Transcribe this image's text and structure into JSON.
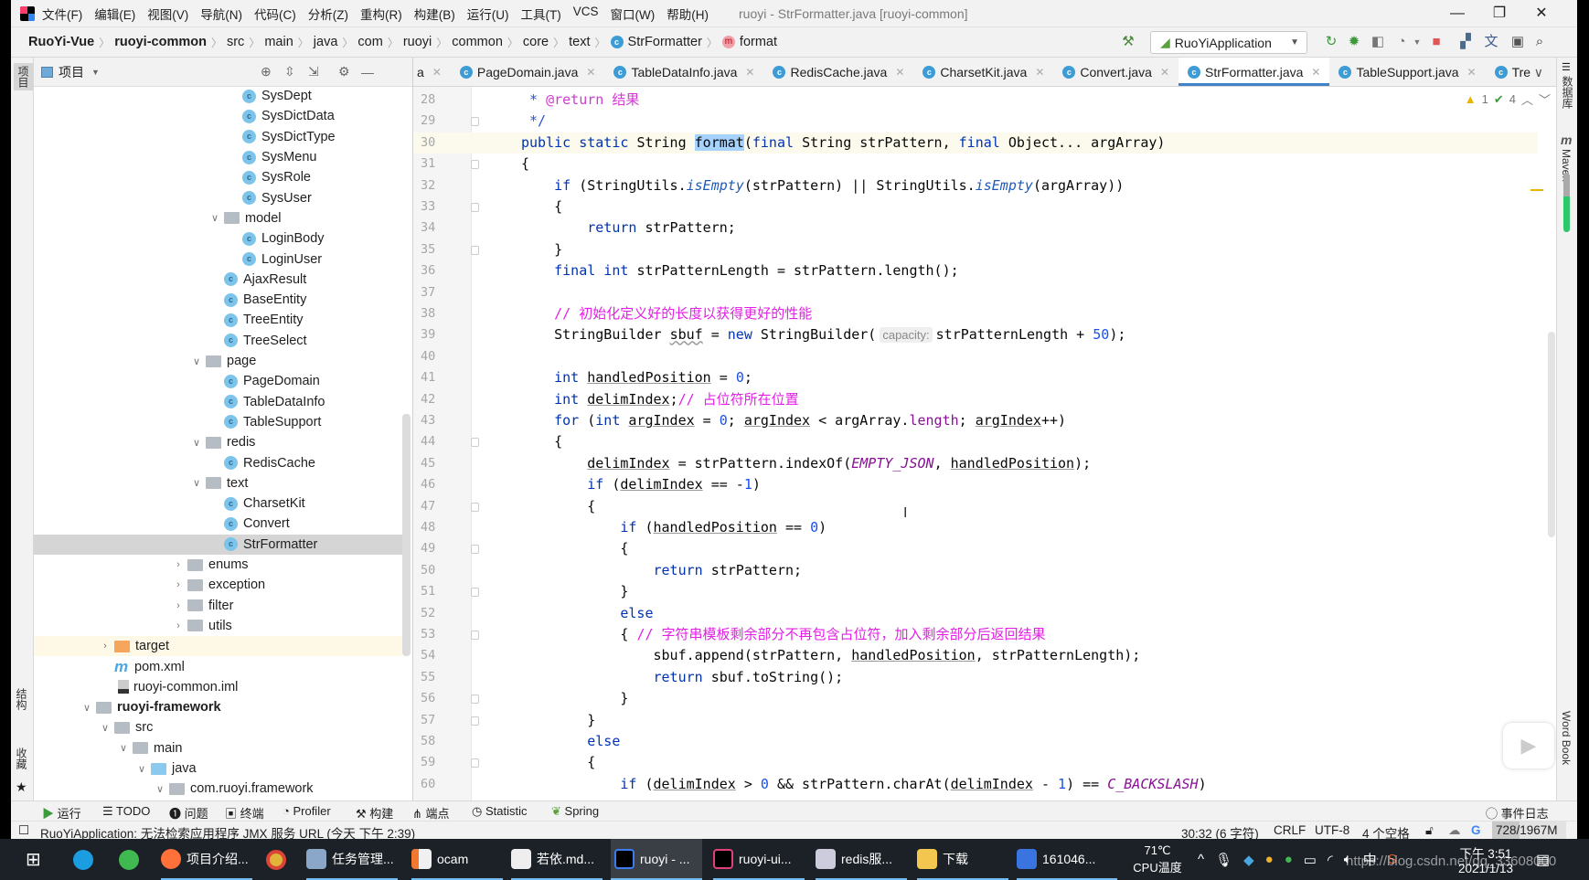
{
  "window": {
    "title": "ruoyi - StrFormatter.java [ruoyi-common]",
    "menu": [
      "文件(F)",
      "编辑(E)",
      "视图(V)",
      "导航(N)",
      "代码(C)",
      "分析(Z)",
      "重构(R)",
      "构建(B)",
      "运行(U)",
      "工具(T)",
      "VCS",
      "窗口(W)",
      "帮助(H)"
    ],
    "controls": {
      "minimize": "—",
      "restore": "❐",
      "close": "✕"
    }
  },
  "breadcrumb": [
    "RuoYi-Vue",
    "ruoyi-common",
    "src",
    "main",
    "java",
    "com",
    "ruoyi",
    "common",
    "core",
    "text",
    "StrFormatter",
    "format"
  ],
  "toolbar": {
    "run_config": "RuoYiApplication",
    "icons": [
      "hammer-icon",
      "rerun-icon",
      "debug-icon",
      "coverage-icon",
      "profile-icon",
      "stop-icon",
      "project-structure-icon",
      "translate-icon",
      "presentation-icon",
      "search-icon"
    ]
  },
  "project_panel": {
    "title": "项目",
    "tree": [
      {
        "label": "SysDept",
        "depth": 8,
        "kind": "class"
      },
      {
        "label": "SysDictData",
        "depth": 8,
        "kind": "class"
      },
      {
        "label": "SysDictType",
        "depth": 8,
        "kind": "class"
      },
      {
        "label": "SysMenu",
        "depth": 8,
        "kind": "class"
      },
      {
        "label": "SysRole",
        "depth": 8,
        "kind": "class"
      },
      {
        "label": "SysUser",
        "depth": 8,
        "kind": "class"
      },
      {
        "label": "model",
        "depth": 7,
        "kind": "package",
        "expanded": true
      },
      {
        "label": "LoginBody",
        "depth": 8,
        "kind": "class"
      },
      {
        "label": "LoginUser",
        "depth": 8,
        "kind": "class"
      },
      {
        "label": "AjaxResult",
        "depth": 7,
        "kind": "class"
      },
      {
        "label": "BaseEntity",
        "depth": 7,
        "kind": "class"
      },
      {
        "label": "TreeEntity",
        "depth": 7,
        "kind": "class"
      },
      {
        "label": "TreeSelect",
        "depth": 7,
        "kind": "class"
      },
      {
        "label": "page",
        "depth": 6,
        "kind": "package",
        "expanded": true
      },
      {
        "label": "PageDomain",
        "depth": 7,
        "kind": "class"
      },
      {
        "label": "TableDataInfo",
        "depth": 7,
        "kind": "class"
      },
      {
        "label": "TableSupport",
        "depth": 7,
        "kind": "class"
      },
      {
        "label": "redis",
        "depth": 6,
        "kind": "package",
        "expanded": true
      },
      {
        "label": "RedisCache",
        "depth": 7,
        "kind": "class"
      },
      {
        "label": "text",
        "depth": 6,
        "kind": "package",
        "expanded": true
      },
      {
        "label": "CharsetKit",
        "depth": 7,
        "kind": "class"
      },
      {
        "label": "Convert",
        "depth": 7,
        "kind": "class"
      },
      {
        "label": "StrFormatter",
        "depth": 7,
        "kind": "class",
        "selected": true
      },
      {
        "label": "enums",
        "depth": 5,
        "kind": "package",
        "expanded": false
      },
      {
        "label": "exception",
        "depth": 5,
        "kind": "package",
        "expanded": false
      },
      {
        "label": "filter",
        "depth": 5,
        "kind": "package",
        "expanded": false
      },
      {
        "label": "utils",
        "depth": 5,
        "kind": "package",
        "expanded": false
      },
      {
        "label": "target",
        "depth": 1,
        "kind": "excluded-folder",
        "expanded": false
      },
      {
        "label": "pom.xml",
        "depth": 1,
        "kind": "maven"
      },
      {
        "label": "ruoyi-common.iml",
        "depth": 1,
        "kind": "iml"
      },
      {
        "label": "ruoyi-framework",
        "depth": 0,
        "kind": "module",
        "expanded": true
      },
      {
        "label": "src",
        "depth": 1,
        "kind": "folder",
        "expanded": true
      },
      {
        "label": "main",
        "depth": 2,
        "kind": "folder",
        "expanded": true
      },
      {
        "label": "java",
        "depth": 3,
        "kind": "source-folder",
        "expanded": true
      },
      {
        "label": "com.ruoyi.framework",
        "depth": 4,
        "kind": "package",
        "expanded": true
      }
    ]
  },
  "left_strip": {
    "top": "项目",
    "structure": "结构",
    "favorites": "收藏"
  },
  "right_strip": {
    "database": "数据库",
    "maven": "Maven",
    "wordbook": "Word Book"
  },
  "editor": {
    "tabs": [
      {
        "label": "a"
      },
      {
        "label": "PageDomain.java"
      },
      {
        "label": "TableDataInfo.java"
      },
      {
        "label": "RedisCache.java"
      },
      {
        "label": "CharsetKit.java"
      },
      {
        "label": "Convert.java"
      },
      {
        "label": "StrFormatter.java",
        "active": true
      },
      {
        "label": "TableSupport.java"
      },
      {
        "label": "Tre"
      }
    ],
    "inspections": {
      "warnings": "1",
      "typos": "4"
    },
    "current_line": 30,
    "lines": [
      {
        "n": 28,
        "tokens": [
          [
            " * ",
            "d"
          ],
          [
            "@return",
            "dt"
          ],
          [
            " 结果",
            "dt"
          ]
        ]
      },
      {
        "n": 29,
        "fold": true,
        "tokens": [
          [
            " */",
            "d"
          ]
        ]
      },
      {
        "n": 30,
        "tokens": [
          [
            "public static ",
            "k"
          ],
          [
            "String ",
            "t"
          ],
          [
            "format",
            "s"
          ],
          [
            "(",
            "t"
          ],
          [
            "final ",
            "k"
          ],
          [
            "String strPattern, ",
            "t"
          ],
          [
            "final ",
            "k"
          ],
          [
            "Object... argArray)",
            "t"
          ]
        ]
      },
      {
        "n": 31,
        "fold": true,
        "tokens": [
          [
            "{",
            "t"
          ]
        ]
      },
      {
        "n": 32,
        "tokens": [
          [
            "    ",
            "t"
          ],
          [
            "if ",
            "k"
          ],
          [
            "(StringUtils.",
            "t"
          ],
          [
            "isEmpty",
            "i"
          ],
          [
            "(strPattern) || StringUtils.",
            "t"
          ],
          [
            "isEmpty",
            "i"
          ],
          [
            "(argArray))",
            "t"
          ]
        ]
      },
      {
        "n": 33,
        "fold": true,
        "tokens": [
          [
            "    {",
            "t"
          ]
        ]
      },
      {
        "n": 34,
        "tokens": [
          [
            "        ",
            "t"
          ],
          [
            "return ",
            "k"
          ],
          [
            "strPattern;",
            "t"
          ]
        ]
      },
      {
        "n": 35,
        "fold": true,
        "tokens": [
          [
            "    }",
            "t"
          ]
        ]
      },
      {
        "n": 36,
        "tokens": [
          [
            "    ",
            "t"
          ],
          [
            "final int ",
            "k"
          ],
          [
            "strPatternLength = strPattern.length();",
            "t"
          ]
        ]
      },
      {
        "n": 37,
        "tokens": []
      },
      {
        "n": 38,
        "tokens": [
          [
            "    ",
            "t"
          ],
          [
            "// 初始化定义好的长度以获得更好的性能",
            "c"
          ]
        ]
      },
      {
        "n": 39,
        "tokens": [
          [
            "    StringBuilder ",
            "t"
          ],
          [
            "sbuf",
            "w"
          ],
          [
            " = ",
            "t"
          ],
          [
            "new ",
            "k"
          ],
          [
            "StringBuilder(",
            "t"
          ],
          [
            "capacity:",
            "h"
          ],
          [
            "strPatternLength + ",
            "t"
          ],
          [
            "50",
            "n"
          ],
          [
            ");",
            "t"
          ]
        ]
      },
      {
        "n": 40,
        "tokens": []
      },
      {
        "n": 41,
        "tokens": [
          [
            "    ",
            "t"
          ],
          [
            "int ",
            "k"
          ],
          [
            "handledPosition",
            "u"
          ],
          [
            " = ",
            "t"
          ],
          [
            "0",
            "n"
          ],
          [
            ";",
            "t"
          ]
        ]
      },
      {
        "n": 42,
        "tokens": [
          [
            "    ",
            "t"
          ],
          [
            "int ",
            "k"
          ],
          [
            "delimIndex",
            "u"
          ],
          [
            ";",
            "t"
          ],
          [
            "// 占位符所在位置",
            "c"
          ]
        ]
      },
      {
        "n": 43,
        "tokens": [
          [
            "    ",
            "t"
          ],
          [
            "for ",
            "k"
          ],
          [
            "(",
            "t"
          ],
          [
            "int ",
            "k"
          ],
          [
            "argIndex",
            "u"
          ],
          [
            " = ",
            "t"
          ],
          [
            "0",
            "n"
          ],
          [
            "; ",
            "t"
          ],
          [
            "argIndex",
            "u"
          ],
          [
            " < argArray.",
            "t"
          ],
          [
            "length",
            "f"
          ],
          [
            "; ",
            "t"
          ],
          [
            "argIndex",
            "u"
          ],
          [
            "++)",
            "t"
          ]
        ]
      },
      {
        "n": 44,
        "fold": true,
        "tokens": [
          [
            "    {",
            "t"
          ]
        ]
      },
      {
        "n": 45,
        "tokens": [
          [
            "        ",
            "t"
          ],
          [
            "delimIndex",
            "u"
          ],
          [
            " = strPattern.indexOf(",
            "t"
          ],
          [
            "EMPTY_JSON",
            "p"
          ],
          [
            ", ",
            "t"
          ],
          [
            "handledPosition",
            "u"
          ],
          [
            ");",
            "t"
          ]
        ]
      },
      {
        "n": 46,
        "tokens": [
          [
            "        ",
            "t"
          ],
          [
            "if ",
            "k"
          ],
          [
            "(",
            "t"
          ],
          [
            "delimIndex",
            "u"
          ],
          [
            " == -",
            "t"
          ],
          [
            "1",
            "n"
          ],
          [
            ")",
            "t"
          ]
        ]
      },
      {
        "n": 47,
        "fold": true,
        "tokens": [
          [
            "        {",
            "t"
          ]
        ]
      },
      {
        "n": 48,
        "tokens": [
          [
            "            ",
            "t"
          ],
          [
            "if ",
            "k"
          ],
          [
            "(",
            "t"
          ],
          [
            "handledPosition",
            "u"
          ],
          [
            " == ",
            "t"
          ],
          [
            "0",
            "n"
          ],
          [
            ")",
            "t"
          ]
        ]
      },
      {
        "n": 49,
        "fold": true,
        "tokens": [
          [
            "            {",
            "t"
          ]
        ]
      },
      {
        "n": 50,
        "tokens": [
          [
            "                ",
            "t"
          ],
          [
            "return ",
            "k"
          ],
          [
            "strPattern;",
            "t"
          ]
        ]
      },
      {
        "n": 51,
        "fold": true,
        "tokens": [
          [
            "            }",
            "t"
          ]
        ]
      },
      {
        "n": 52,
        "tokens": [
          [
            "            ",
            "t"
          ],
          [
            "else",
            "k"
          ]
        ]
      },
      {
        "n": 53,
        "fold": true,
        "tokens": [
          [
            "            { ",
            "t"
          ],
          [
            "// 字符串模板剩余部分不再包含占位符，加入剩余部分后返回结果",
            "c"
          ]
        ]
      },
      {
        "n": 54,
        "tokens": [
          [
            "                sbuf.append(strPattern, ",
            "t"
          ],
          [
            "handledPosition",
            "u"
          ],
          [
            ", strPatternLength);",
            "t"
          ]
        ]
      },
      {
        "n": 55,
        "tokens": [
          [
            "                ",
            "t"
          ],
          [
            "return ",
            "k"
          ],
          [
            "sbuf.toString();",
            "t"
          ]
        ]
      },
      {
        "n": 56,
        "fold": true,
        "tokens": [
          [
            "            }",
            "t"
          ]
        ]
      },
      {
        "n": 57,
        "fold": true,
        "tokens": [
          [
            "        }",
            "t"
          ]
        ]
      },
      {
        "n": 58,
        "tokens": [
          [
            "        ",
            "t"
          ],
          [
            "else",
            "k"
          ]
        ]
      },
      {
        "n": 59,
        "fold": true,
        "tokens": [
          [
            "        {",
            "t"
          ]
        ]
      },
      {
        "n": 60,
        "tokens": [
          [
            "            ",
            "t"
          ],
          [
            "if ",
            "k"
          ],
          [
            "(",
            "t"
          ],
          [
            "delimIndex",
            "u"
          ],
          [
            " > ",
            "t"
          ],
          [
            "0",
            "n"
          ],
          [
            " && strPattern.charAt(",
            "t"
          ],
          [
            "delimIndex",
            "u"
          ],
          [
            " - ",
            "t"
          ],
          [
            "1",
            "n"
          ],
          [
            ") == ",
            "t"
          ],
          [
            "C_BACKSLASH",
            "p"
          ],
          [
            ")",
            "t"
          ]
        ]
      }
    ]
  },
  "tool_windows": [
    "运行",
    "TODO",
    "问题",
    "终端",
    "Profiler",
    "构建",
    "端点",
    "Statistic",
    "Spring"
  ],
  "event_log": "事件日志",
  "status": {
    "message": "RuoYiApplication: 无法检索应用程序 JMX 服务 URL (今天 下午 2:39)",
    "position": "30:32 (6 字符)",
    "line_sep": "CRLF",
    "encoding": "UTF-8",
    "indent": "4 个空格",
    "memory": "728/1967M",
    "memory_used_fraction": 0.37
  },
  "taskbar": {
    "apps": [
      "项目介绍...",
      "任务管理...",
      "ocam",
      "若依.md...",
      "ruoyi - ...",
      "ruoyi-ui...",
      "redis服...",
      "下载",
      "161046..."
    ],
    "cpu_temp": "71℃",
    "cpu_label": "CPU温度",
    "time": "下午 3:51",
    "date": "2021/1/13",
    "watermark": "https://blog.csdn.net/qq_33608000"
  }
}
